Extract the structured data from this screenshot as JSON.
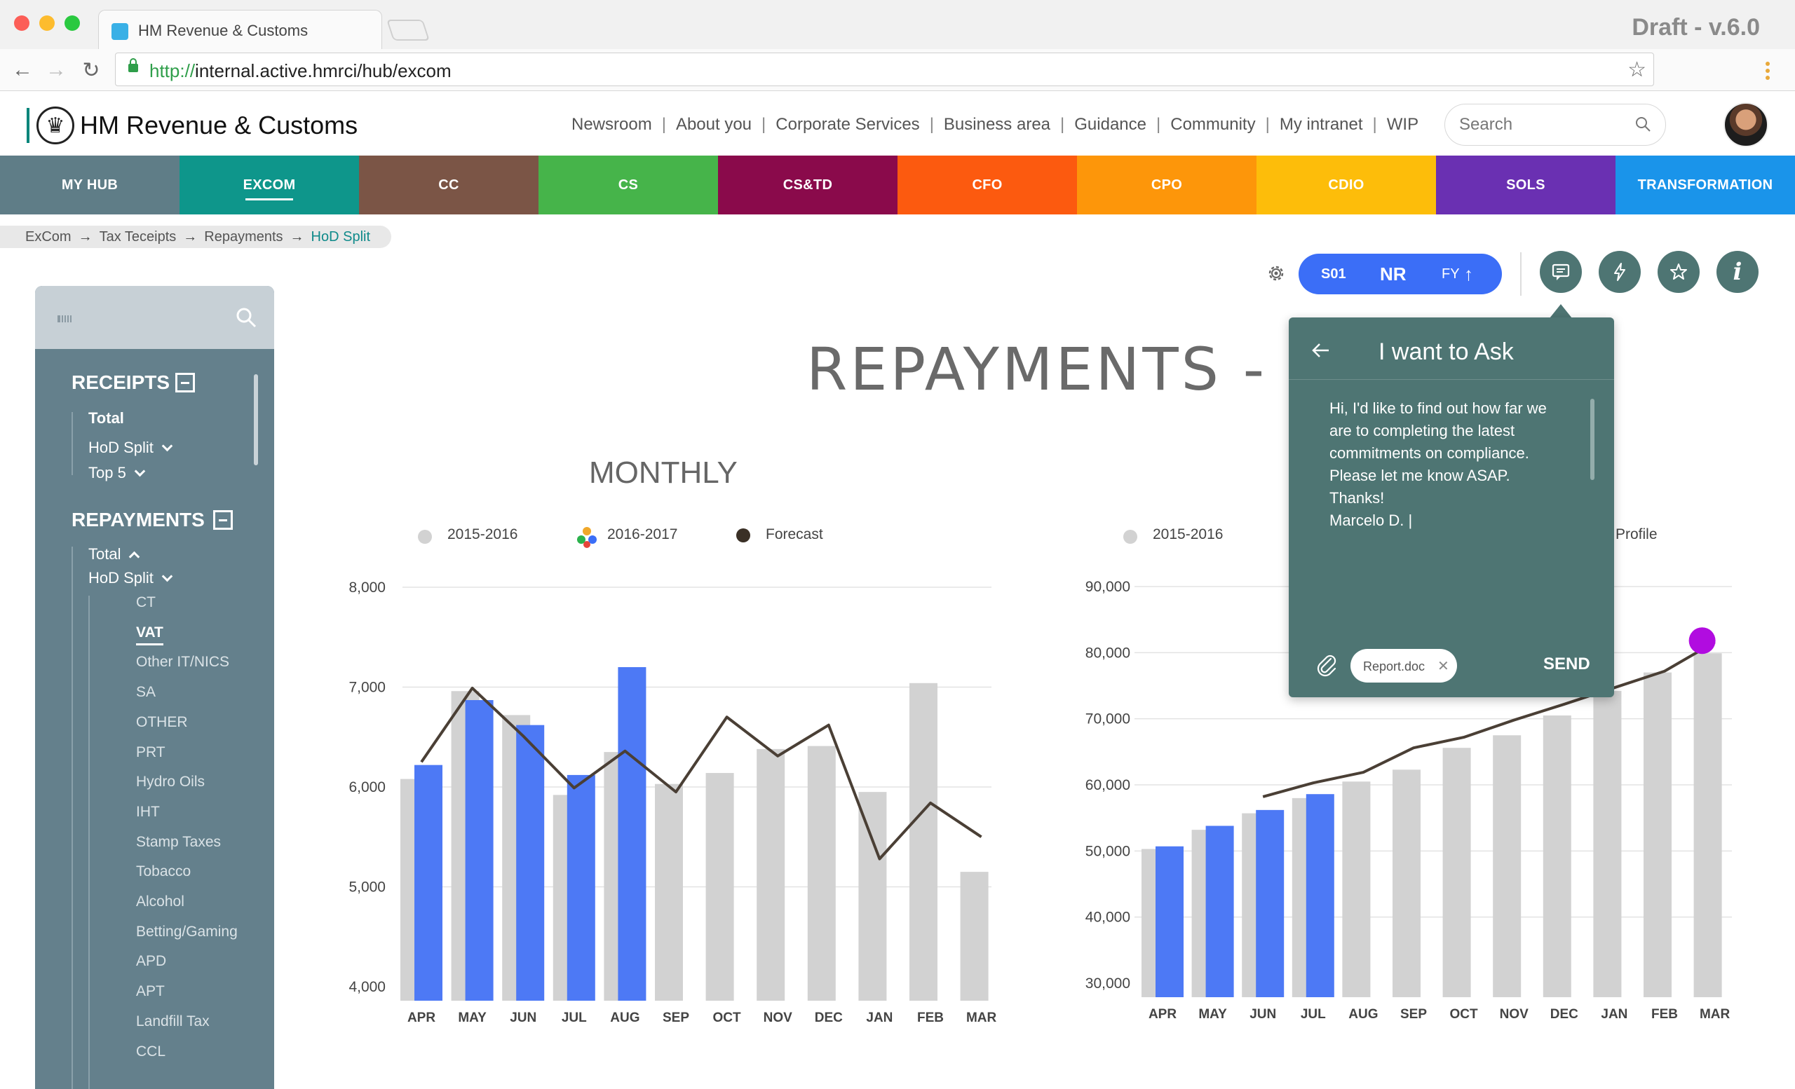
{
  "browser": {
    "tab_title": "HM Revenue & Customs",
    "url_scheme": "http://",
    "url_rest": "internal.active.hmrci/hub/excom",
    "version": "Draft - v.6.0"
  },
  "header": {
    "brand": "HM Revenue & Customs",
    "nav": [
      "Newsroom",
      "About you",
      "Corporate Services",
      "Business area",
      "Guidance",
      "Community",
      "My intranet",
      "WIP"
    ],
    "search_placeholder": "Search"
  },
  "divisions": [
    {
      "label": "MY HUB",
      "color": "#5f7d87",
      "active": false
    },
    {
      "label": "EXCOM",
      "color": "#0e968b",
      "active": true
    },
    {
      "label": "CC",
      "color": "#7b5546",
      "active": false
    },
    {
      "label": "CS",
      "color": "#46b44a",
      "active": false
    },
    {
      "label": "CS&TD",
      "color": "#8a0a4b",
      "active": false
    },
    {
      "label": "CFO",
      "color": "#fc5a0f",
      "active": false
    },
    {
      "label": "CPO",
      "color": "#fd960a",
      "active": false
    },
    {
      "label": "CDIO",
      "color": "#fdbd0a",
      "active": false
    },
    {
      "label": "SOLS",
      "color": "#6a30b2",
      "active": false
    },
    {
      "label": "TRANSFORMATION",
      "color": "#1a94ea",
      "active": false
    }
  ],
  "breadcrumb": [
    "ExCom",
    "Tax Teceipts",
    "Repayments",
    "HoD Split"
  ],
  "toolbar": {
    "s01": "S01",
    "nr": "NR",
    "fy": "FY",
    "fy_arrow": "🡑"
  },
  "sidebar": {
    "receipts_title": "RECEIPTS",
    "receipts_items": [
      "Total",
      "HoD Split",
      "Top 5"
    ],
    "repayments_title": "REPAYMENTS",
    "repayments_items": [
      "Total",
      "HoD Split"
    ],
    "hod_items": [
      "CT",
      "VAT",
      "Other IT/NICS",
      "SA",
      "OTHER",
      "PRT",
      "Hydro Oils",
      "IHT",
      "Stamp Taxes",
      "Tobacco",
      "Alcohol",
      "Betting/Gaming",
      "APD",
      "APT",
      "Landfill Tax",
      "CCL"
    ],
    "selected": "VAT"
  },
  "main": {
    "title": "REPAYMENTS - VAT",
    "monthly_title": "MONTHLY"
  },
  "legend_left": [
    "2015-2016",
    "2016-2017",
    "Forecast"
  ],
  "legend_right": [
    "2015-2016",
    "Profile"
  ],
  "ask": {
    "title": "I want to Ask",
    "message": "Hi, I'd like to find out how far we\nare to completing the latest\ncommitments on compliance.\nPlease let me know ASAP.\nThanks!\nMarcelo D. |",
    "attachment": "Report.doc",
    "send": "SEND"
  },
  "chart_data": [
    {
      "type": "bar",
      "title": "MONTHLY",
      "categories": [
        "APR",
        "MAY",
        "JUN",
        "JUL",
        "AUG",
        "SEP",
        "OCT",
        "NOV",
        "DEC",
        "JAN",
        "FEB",
        "MAR"
      ],
      "ylim": [
        4000,
        8000
      ],
      "yticks": [
        "4,000",
        "5,000",
        "6,000",
        "7,000",
        "8,000"
      ],
      "grid": true,
      "series": [
        {
          "name": "2015-2016",
          "kind": "bar",
          "color": "#d2d2d2",
          "values": [
            6080,
            6960,
            6720,
            5920,
            6350,
            6030,
            6140,
            6380,
            6410,
            5950,
            7040,
            5150
          ]
        },
        {
          "name": "2016-2017",
          "kind": "bar",
          "color": "#4d79f5",
          "values": [
            6220,
            6870,
            6620,
            6120,
            7200,
            null,
            null,
            null,
            null,
            null,
            null,
            null
          ]
        },
        {
          "name": "Forecast",
          "kind": "line",
          "color": "#4a3f35",
          "values": [
            6250,
            6990,
            6510,
            5990,
            6360,
            5950,
            6700,
            6310,
            6620,
            5280,
            5840,
            5500
          ]
        }
      ]
    },
    {
      "type": "bar",
      "categories": [
        "APR",
        "MAY",
        "JUN",
        "JUL",
        "AUG",
        "SEP",
        "OCT",
        "NOV",
        "DEC",
        "JAN",
        "FEB",
        "MAR"
      ],
      "ylim": [
        30000,
        90000
      ],
      "yticks": [
        "30,000",
        "40,000",
        "50,000",
        "60,000",
        "70,000",
        "80,000",
        "90,000"
      ],
      "grid": true,
      "series": [
        {
          "name": "2015-2016",
          "kind": "bar",
          "color": "#d2d2d2",
          "values": [
            50300,
            53200,
            55700,
            58000,
            60500,
            62300,
            65600,
            67500,
            70500,
            74200,
            77000,
            79900
          ]
        },
        {
          "name": "2016-2017",
          "kind": "bar",
          "color": "#4d79f5",
          "values": [
            50700,
            53800,
            56200,
            58600,
            null,
            null,
            null,
            null,
            null,
            null,
            null,
            null
          ]
        },
        {
          "name": "Profile",
          "kind": "line",
          "color": "#4a3f35",
          "values": [
            null,
            null,
            58200,
            60300,
            61900,
            65600,
            67200,
            69800,
            72200,
            74700,
            77200,
            81600
          ]
        }
      ],
      "highlight_point": {
        "month": "MAR",
        "value": 81600,
        "color": "#b10ce0"
      }
    }
  ]
}
